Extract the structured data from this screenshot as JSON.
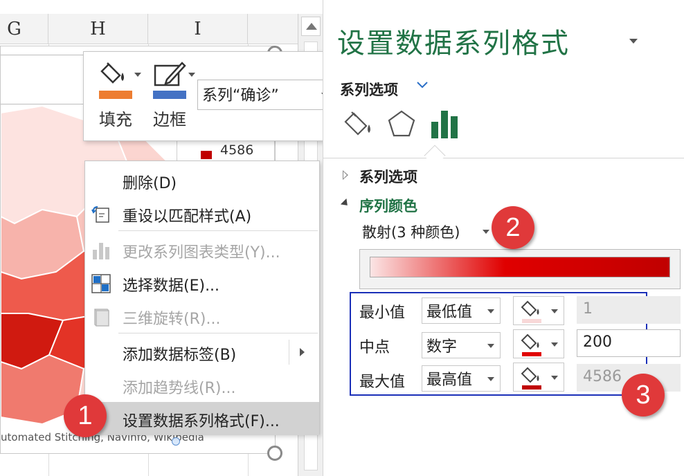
{
  "sheet": {
    "columns": [
      "G",
      "H",
      "I"
    ],
    "legend_value": "4586",
    "source_text": "utomated Stitching, Navinfo, Wikipedia"
  },
  "mini_toolbar": {
    "fill_label": "填充",
    "border_label": "边框",
    "series_select_value": "系列“确诊”",
    "fill_color": "#ed7d31",
    "border_color": "#4472c4"
  },
  "context_menu": {
    "items": [
      {
        "label": "删除(D)",
        "enabled": true
      },
      {
        "label": "重设以匹配样式(A)",
        "enabled": true
      },
      {
        "label": "更改系列图表类型(Y)...",
        "enabled": false
      },
      {
        "label": "选择数据(E)...",
        "enabled": true
      },
      {
        "label": "三维旋转(R)...",
        "enabled": false
      },
      {
        "label": "添加数据标签(B)",
        "enabled": true
      },
      {
        "label": "添加趋势线(R)...",
        "enabled": false
      },
      {
        "label": "设置数据系列格式(F)...",
        "enabled": true
      }
    ]
  },
  "badges": [
    "1",
    "2",
    "3"
  ],
  "pane": {
    "title": "设置数据系列格式",
    "series_options_dropdown": "系列选项",
    "section_series_options": "系列选项",
    "section_series_color": "序列颜色",
    "color_scheme": "散射(3 种颜色)",
    "gradient": {
      "start": "#fbe5e5",
      "mid": "#e00000",
      "end": "#c00000"
    },
    "rows": [
      {
        "label": "最小值",
        "type": "最低值",
        "color": "#f8d8d8",
        "value": "1",
        "editable": false
      },
      {
        "label": "中点",
        "type": "数字",
        "color": "#e00000",
        "value": "200",
        "editable": true
      },
      {
        "label": "最大值",
        "type": "最高值",
        "color": "#c00000",
        "value": "4586",
        "editable": false
      }
    ],
    "accent_color": "#217346"
  }
}
